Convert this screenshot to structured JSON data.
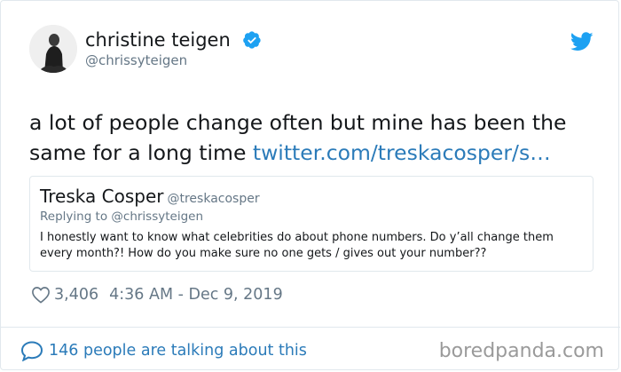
{
  "author": {
    "name": "christine teigen",
    "handle": "@chrissyteigen"
  },
  "tweet": {
    "text": "a lot of people change often but mine has been the same for a long time ",
    "link": "twitter.com/treskacosper/s…"
  },
  "quoted": {
    "name": "Treska Cosper",
    "handle": "@treskacosper",
    "replying_to": "Replying to @chrissyteigen",
    "text": "I honestly want to know what celebrities do about phone numbers. Do y’all change them every month?! How do you make sure no one gets / gives out your number??"
  },
  "meta": {
    "likes": "3,406",
    "timestamp": "4:36 AM - Dec 9, 2019"
  },
  "footer": {
    "talking": "146 people are talking about this",
    "watermark": "boredpanda.com"
  },
  "colors": {
    "link": "#2b7bb9",
    "verified": "#1da1f2",
    "muted": "#657786",
    "border": "#e1e8ed"
  },
  "icons": [
    "verified-badge-icon",
    "twitter-bird-icon",
    "heart-icon",
    "speech-bubble-icon"
  ]
}
